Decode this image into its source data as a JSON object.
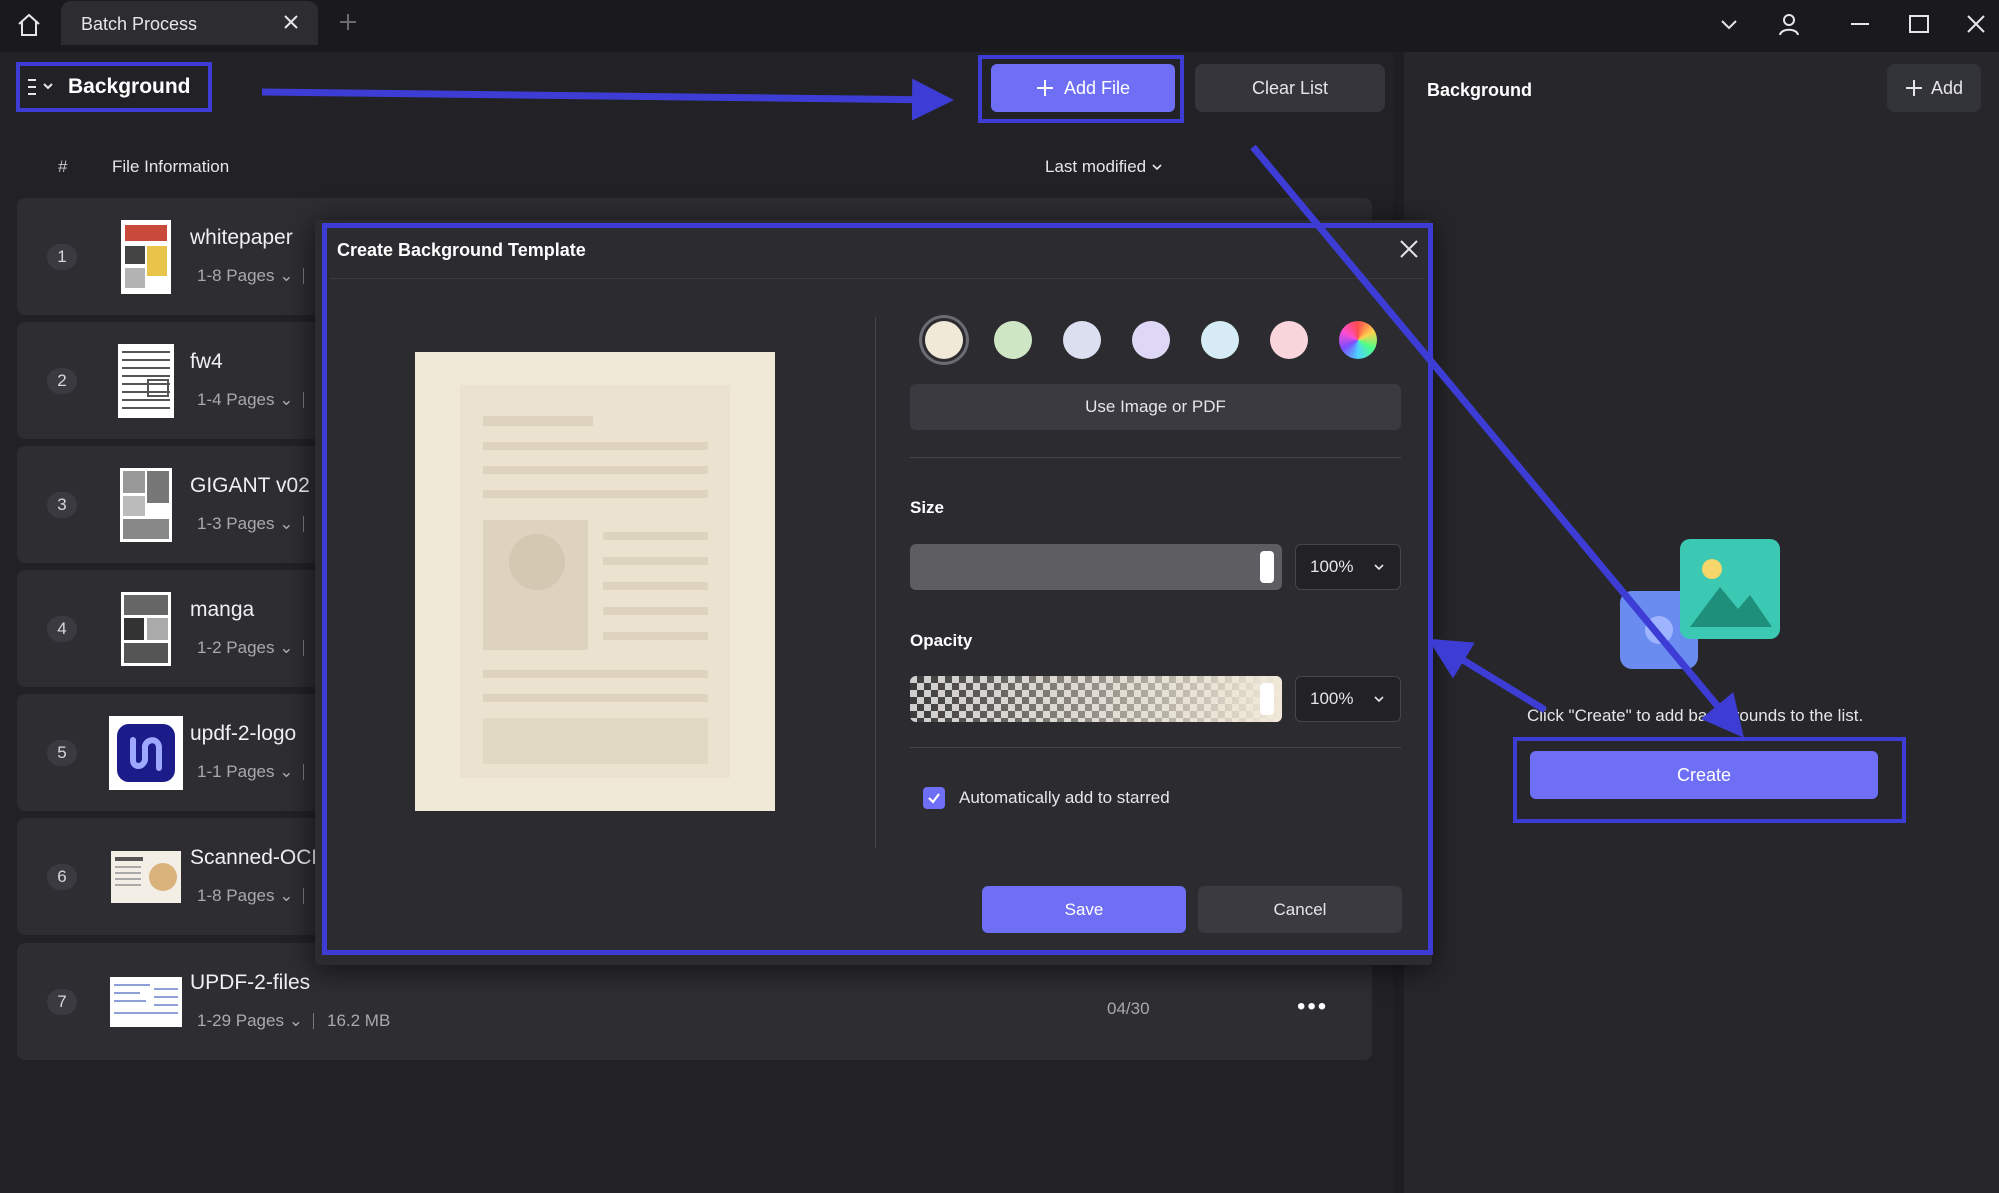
{
  "titlebar": {
    "tab_title": "Batch Process"
  },
  "left": {
    "dropdown_title": "Background",
    "add_file_label": "Add File",
    "clear_list_label": "Clear List",
    "columns": {
      "hash": "#",
      "file_info": "File Information",
      "sort": "Last modified"
    },
    "files": [
      {
        "num": "1",
        "name": "whitepaper",
        "pages": "1-8 Pages",
        "size": "",
        "date": ""
      },
      {
        "num": "2",
        "name": "fw4",
        "pages": "1-4 Pages",
        "size": "",
        "date": ""
      },
      {
        "num": "3",
        "name": "GIGANT v02",
        "pages": "1-3 Pages",
        "size": "",
        "date": ""
      },
      {
        "num": "4",
        "name": "manga",
        "pages": "1-2 Pages",
        "size": "",
        "date": ""
      },
      {
        "num": "5",
        "name": "updf-2-logo",
        "pages": "1-1 Pages",
        "size": "",
        "date": ""
      },
      {
        "num": "6",
        "name": "Scanned-OCR",
        "pages": "1-8 Pages",
        "size": "",
        "date": ""
      },
      {
        "num": "7",
        "name": "UPDF-2-files",
        "pages": "1-29 Pages",
        "size": "16.2 MB",
        "date": "04/30"
      }
    ]
  },
  "right": {
    "title": "Background",
    "add_label": "Add",
    "hint": "Click \"Create\" to add backgrounds to the list.",
    "create_label": "Create"
  },
  "dialog": {
    "title": "Create Background Template",
    "swatches": [
      "#f1e9d8",
      "#cfe6c4",
      "#dcdff0",
      "#ded7f6",
      "#d6ebf6",
      "#f8d6dc",
      "rainbow"
    ],
    "use_image_label": "Use Image or PDF",
    "size_label": "Size",
    "size_value": "100%",
    "size_level": 1.0,
    "opacity_label": "Opacity",
    "opacity_value": "100%",
    "opacity_level": 1.0,
    "auto_star_label": "Automatically add to starred",
    "auto_star_checked": true,
    "save_label": "Save",
    "cancel_label": "Cancel"
  },
  "colors": {
    "accent": "#6f6ff6",
    "annotation": "#3d3dd6",
    "preview_bg": "#f1e9d8"
  }
}
